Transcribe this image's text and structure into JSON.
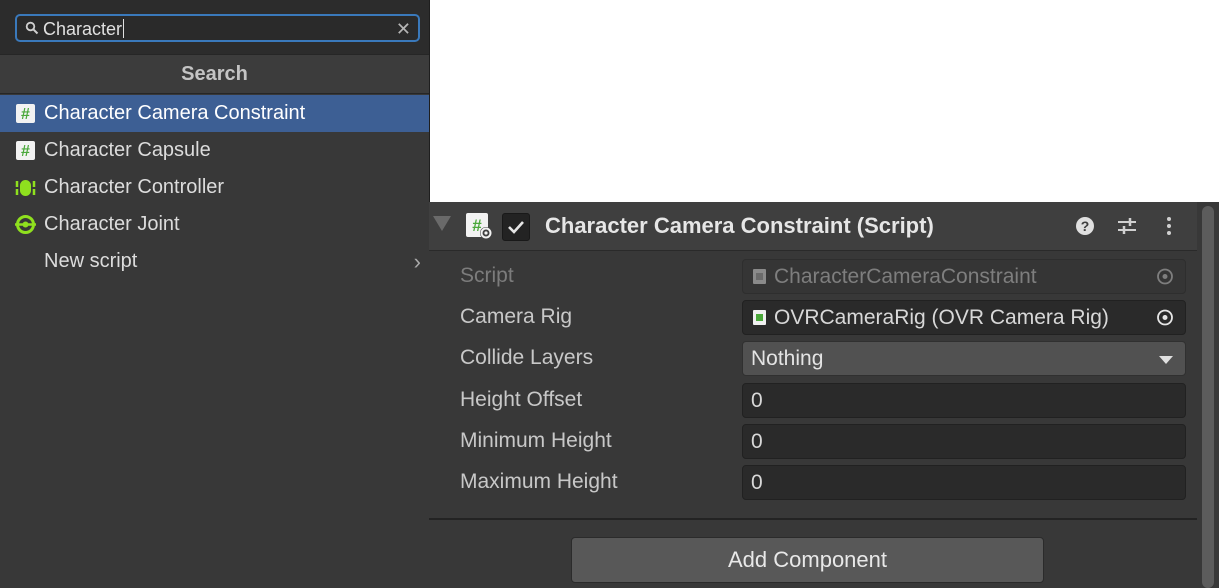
{
  "search": {
    "query": "Character",
    "header": "Search",
    "results": [
      {
        "label": "Character Camera Constraint",
        "icon": "script-icon",
        "selected": true
      },
      {
        "label": "Character Capsule",
        "icon": "script-icon",
        "selected": false
      },
      {
        "label": "Character Controller",
        "icon": "character-controller-icon",
        "selected": false
      },
      {
        "label": "Character Joint",
        "icon": "character-joint-icon",
        "selected": false
      },
      {
        "label": "New script",
        "icon": "chevron-right-icon",
        "selected": false
      }
    ]
  },
  "inspector": {
    "component_title": "Character Camera Constraint (Script)",
    "enabled": true,
    "properties": [
      {
        "label": "Script",
        "value": "CharacterCameraConstraint",
        "type": "object",
        "disabled": true
      },
      {
        "label": "Camera Rig",
        "value": "OVRCameraRig (OVR Camera Rig)",
        "type": "object",
        "disabled": false
      },
      {
        "label": "Collide Layers",
        "value": "Nothing",
        "type": "dropdown",
        "disabled": false
      },
      {
        "label": "Height Offset",
        "value": "0",
        "type": "number",
        "disabled": false
      },
      {
        "label": "Minimum Height",
        "value": "0",
        "type": "number",
        "disabled": false
      },
      {
        "label": "Maximum Height",
        "value": "0",
        "type": "number",
        "disabled": false
      }
    ],
    "add_component_label": "Add Component"
  },
  "colors": {
    "selection": "#3d5f94",
    "script_icon_green": "#6cc24a",
    "component_icon_green": "#7ce21e",
    "focus_border": "#3a79bb"
  }
}
